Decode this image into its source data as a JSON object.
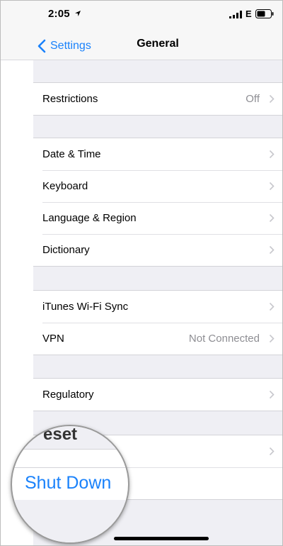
{
  "status_bar": {
    "time": "2:05",
    "network": "E"
  },
  "nav": {
    "back_label": "Settings",
    "title": "General"
  },
  "groups": [
    {
      "rows": [
        {
          "label": "Restrictions",
          "detail": "Off"
        }
      ]
    },
    {
      "rows": [
        {
          "label": "Date & Time",
          "detail": ""
        },
        {
          "label": "Keyboard",
          "detail": ""
        },
        {
          "label": "Language & Region",
          "detail": ""
        },
        {
          "label": "Dictionary",
          "detail": ""
        }
      ]
    },
    {
      "rows": [
        {
          "label": "iTunes Wi-Fi Sync",
          "detail": ""
        },
        {
          "label": "VPN",
          "detail": "Not Connected"
        }
      ]
    },
    {
      "rows": [
        {
          "label": "Regulatory",
          "detail": ""
        }
      ]
    }
  ],
  "magnifier": {
    "partial_label": "eset",
    "shutdown_label": "Shut Down"
  },
  "colors": {
    "accent": "#1a82fb",
    "group_background": "#efeff4",
    "detail_text": "#8e8e93"
  }
}
